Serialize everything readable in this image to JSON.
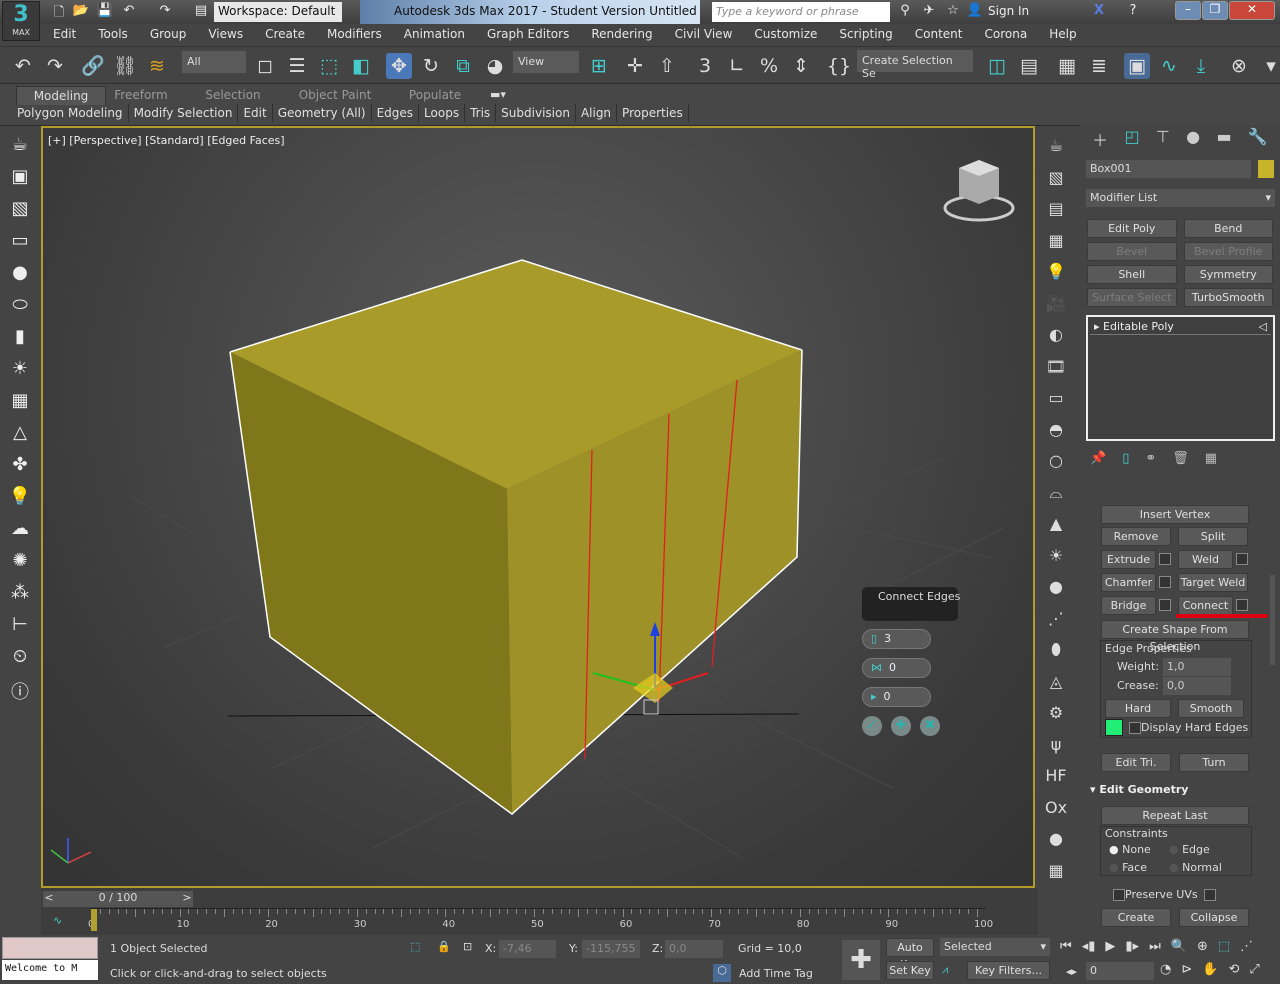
{
  "app": {
    "logo_number": "3",
    "logo_text": "MAX",
    "workspace": "Workspace: Default",
    "title": "Autodesk 3ds Max 2017 - Student Version    Untitled",
    "search_placeholder": "Type a keyword or phrase",
    "sign_in": "Sign In"
  },
  "menu": [
    "Edit",
    "Tools",
    "Group",
    "Views",
    "Create",
    "Modifiers",
    "Animation",
    "Graph Editors",
    "Rendering",
    "Civil View",
    "Customize",
    "Scripting",
    "Content",
    "Corona",
    "Help"
  ],
  "toolbar": {
    "filter": "All",
    "ref_coord": "View",
    "selection_set": "Create Selection Se"
  },
  "ribbon": {
    "tabs": [
      "Modeling",
      "Freeform",
      "Selection",
      "Object Paint",
      "Populate"
    ],
    "active": "Modeling",
    "panels": [
      "Polygon Modeling",
      "Modify Selection",
      "Edit",
      "Geometry (All)",
      "Edges",
      "Loops",
      "Tris",
      "Subdivision",
      "Align",
      "Properties"
    ]
  },
  "viewport": {
    "label": "[+] [Perspective] [Standard] [Edged Faces]",
    "object_color": "#b0a030",
    "selected_edge_color": "#e02020"
  },
  "caddy": {
    "title": "Connect Edges",
    "segments": "3",
    "pinch": "0",
    "slide": "0"
  },
  "command_panel": {
    "object_name": "Box001",
    "object_color": "#c8b42c",
    "modifier_list": "Modifier List",
    "modifier_buttons": [
      {
        "label": "Edit Poly",
        "enabled": true
      },
      {
        "label": "Bend",
        "enabled": true
      },
      {
        "label": "Bevel",
        "enabled": false
      },
      {
        "label": "Bevel Profile",
        "enabled": false
      },
      {
        "label": "Shell",
        "enabled": true
      },
      {
        "label": "Symmetry",
        "enabled": true
      },
      {
        "label": "Surface Select",
        "enabled": false
      },
      {
        "label": "TurboSmooth",
        "enabled": true
      }
    ],
    "stack_item": "Editable Poly",
    "edit_edges": {
      "insert_vertex": "Insert Vertex",
      "remove": "Remove",
      "split": "Split",
      "extrude": "Extrude",
      "weld": "Weld",
      "chamfer": "Chamfer",
      "target_weld": "Target Weld",
      "bridge": "Bridge",
      "connect": "Connect",
      "create_shape": "Create Shape From Selection",
      "edge_properties": "Edge Properties",
      "weight_label": "Weight:",
      "weight": "1,0",
      "crease_label": "Crease:",
      "crease": "0,0",
      "hard": "Hard",
      "smooth": "Smooth",
      "display_hard_edges": "Display Hard Edges",
      "hard_edge_color": "#22ee77",
      "edit_tri": "Edit Tri.",
      "turn": "Turn"
    },
    "edit_geometry": {
      "title": "Edit Geometry",
      "repeat_last": "Repeat Last",
      "constraints": "Constraints",
      "none": "None",
      "edge": "Edge",
      "face": "Face",
      "normal": "Normal",
      "selected_constraint": "None",
      "preserve_uvs": "Preserve UVs",
      "create": "Create",
      "collapse": "Collapse"
    }
  },
  "timeline": {
    "frame": "0 / 100",
    "ticks": [
      "0",
      "10",
      "20",
      "30",
      "40",
      "50",
      "60",
      "70",
      "80",
      "90",
      "100"
    ]
  },
  "status": {
    "listener": "Welcome to M",
    "selected": "1 Object Selected",
    "prompt": "Click or click-and-drag to select objects",
    "x_label": "X:",
    "x": "-7,46",
    "y_label": "Y:",
    "y": "-115,755",
    "z_label": "Z:",
    "z": "0,0",
    "grid": "Grid = 10,0",
    "add_time_tag": "Add Time Tag",
    "auto_key": "Auto Key",
    "set_key": "Set Key",
    "key_mode": "Selected",
    "key_filters": "Key Filters...",
    "current_frame": "0"
  }
}
